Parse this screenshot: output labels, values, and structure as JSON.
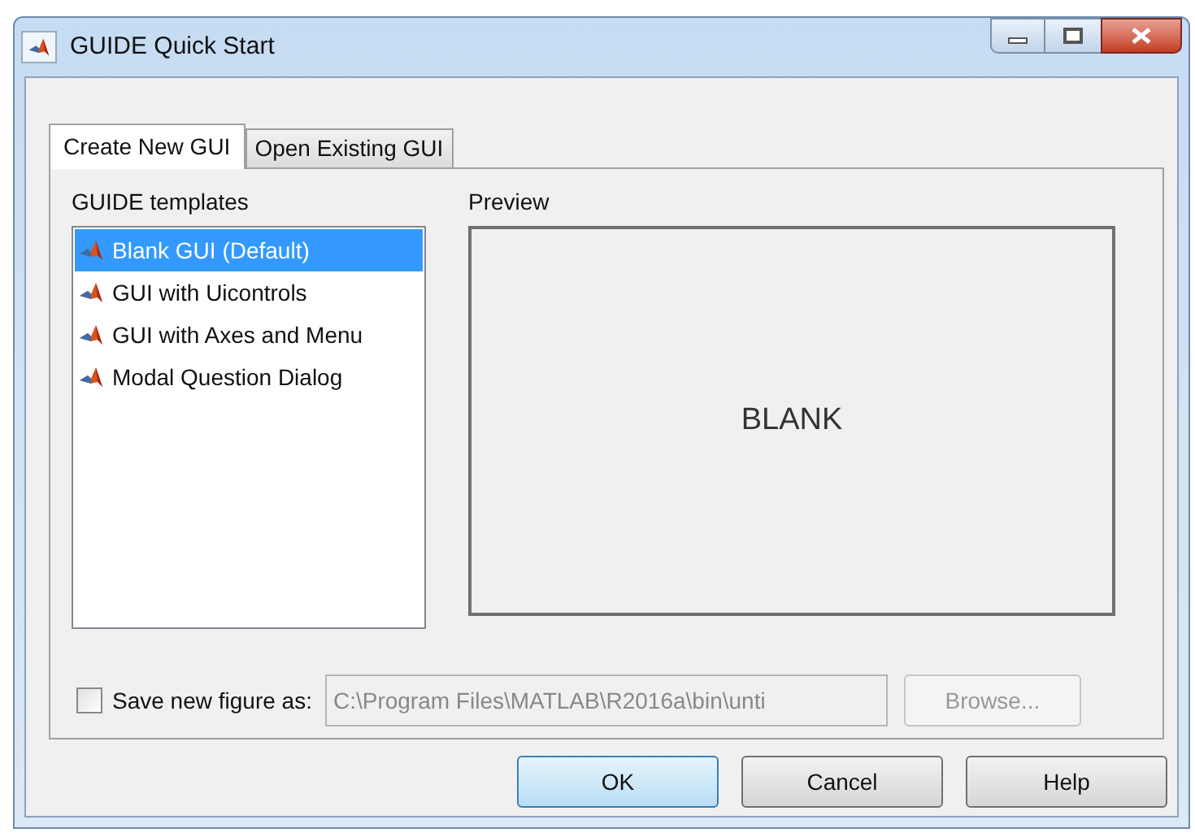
{
  "window": {
    "title": "GUIDE Quick Start"
  },
  "tabs": [
    {
      "label": "Create New GUI",
      "selected": true
    },
    {
      "label": "Open Existing GUI",
      "selected": false
    }
  ],
  "templates": {
    "label": "GUIDE templates",
    "items": [
      {
        "label": "Blank GUI (Default)",
        "selected": true
      },
      {
        "label": "GUI with Uicontrols",
        "selected": false
      },
      {
        "label": "GUI with Axes and Menu",
        "selected": false
      },
      {
        "label": "Modal Question Dialog",
        "selected": false
      }
    ]
  },
  "preview": {
    "label": "Preview",
    "text": "BLANK"
  },
  "save": {
    "label": "Save new figure as:",
    "checked": false,
    "value": "C:\\Program Files\\MATLAB\\R2016a\\bin\\unti",
    "disabled": true
  },
  "browse": {
    "label": "Browse...",
    "disabled": true
  },
  "buttons": [
    {
      "label": "OK",
      "default": true
    },
    {
      "label": "Cancel",
      "default": false
    },
    {
      "label": "Help",
      "default": false
    }
  ]
}
